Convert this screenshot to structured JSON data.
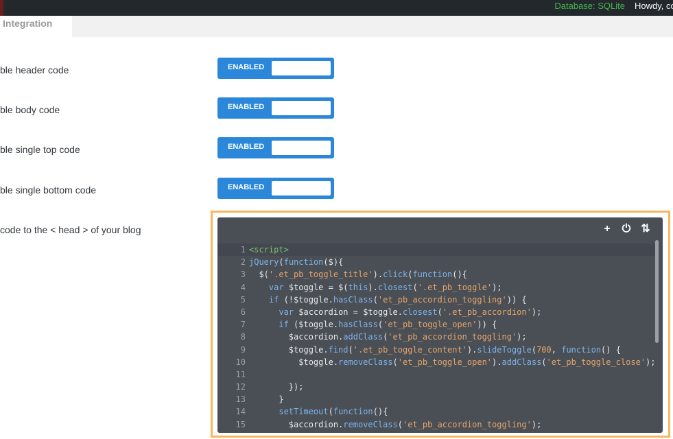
{
  "topbar": {
    "database_label": "Database: SQLite",
    "howdy_label": "Howdy, co"
  },
  "tabs": [
    {
      "label": "Integration"
    }
  ],
  "rows": [
    {
      "label": "ble header code",
      "toggle_state": "ENABLED"
    },
    {
      "label": "ble body code",
      "toggle_state": "ENABLED"
    },
    {
      "label": "ble single top code",
      "toggle_state": "ENABLED"
    },
    {
      "label": "ble single bottom code",
      "toggle_state": "ENABLED"
    }
  ],
  "editor": {
    "label": "code to the < head > of your blog",
    "tools": [
      {
        "icon": "plus-icon",
        "glyph": "+"
      },
      {
        "icon": "power-icon",
        "glyph": "⏻"
      },
      {
        "icon": "sort-icon",
        "glyph": "⇅"
      }
    ],
    "lines": [
      {
        "n": "1",
        "code": "<script>"
      },
      {
        "n": "2",
        "code": "jQuery(function($){"
      },
      {
        "n": "3",
        "code": "  $('.et_pb_toggle_title').click(function(){"
      },
      {
        "n": "4",
        "code": "    var $toggle = $(this).closest('.et_pb_toggle');"
      },
      {
        "n": "5",
        "code": "    if (!$toggle.hasClass('et_pb_accordion_toggling')) {"
      },
      {
        "n": "6",
        "code": "      var $accordion = $toggle.closest('.et_pb_accordion');"
      },
      {
        "n": "7",
        "code": "      if ($toggle.hasClass('et_pb_toggle_open')) {"
      },
      {
        "n": "8",
        "code": "        $accordion.addClass('et_pb_accordion_toggling');"
      },
      {
        "n": "9",
        "code": "        $toggle.find('.et_pb_toggle_content').slideToggle(700, function() {"
      },
      {
        "n": "10",
        "code": "          $toggle.removeClass('et_pb_toggle_open').addClass('et_pb_toggle_close');"
      },
      {
        "n": "11",
        "code": ""
      },
      {
        "n": "12",
        "code": "        });"
      },
      {
        "n": "13",
        "code": "      }"
      },
      {
        "n": "14",
        "code": "      setTimeout(function(){"
      },
      {
        "n": "15",
        "code": "        $accordion.removeClass('et_pb_accordion_toggling');"
      }
    ]
  }
}
